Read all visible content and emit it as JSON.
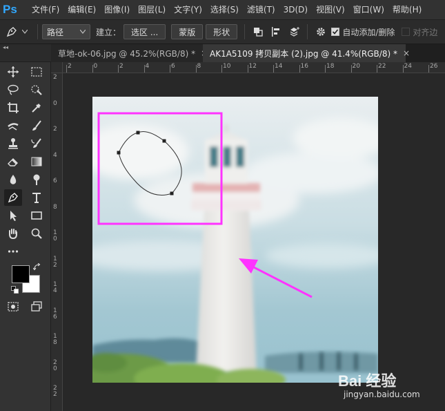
{
  "app": {
    "logo": "Ps"
  },
  "menu": [
    "文件(F)",
    "编辑(E)",
    "图像(I)",
    "图层(L)",
    "文字(Y)",
    "选择(S)",
    "滤镜(T)",
    "3D(D)",
    "视图(V)",
    "窗口(W)",
    "帮助(H)"
  ],
  "options": {
    "mode_value": "路径",
    "make_label": "建立：",
    "selection_button": "选区 ...",
    "mask_button": "蒙版",
    "shape_button": "形状",
    "auto_add_delete": "自动添加/删除",
    "align_edges": "对齐边"
  },
  "tabs": [
    {
      "label": "草地-ok-06.jpg @ 45.2%(RGB/8) *",
      "close": "×",
      "active": false
    },
    {
      "label": "AK1A5109 拷贝副本 (2).jpg @ 41.4%(RGB/8) *",
      "close": "×",
      "active": true
    }
  ],
  "toolbar": {
    "collapse": "◂◂"
  },
  "ruler_h": [
    "2",
    "0",
    "2",
    "4",
    "6",
    "8",
    "10",
    "12",
    "14",
    "16",
    "18",
    "20",
    "22",
    "24",
    "26"
  ],
  "ruler_v": [
    "2",
    "0",
    "2",
    "4",
    "6",
    "8",
    "1\n0",
    "1\n2",
    "1\n4",
    "1\n6",
    "1\n8",
    "2\n0",
    "2\n2"
  ],
  "watermark": {
    "brand": "Bai 经验",
    "url": "jingyan.baidu.com"
  },
  "colors": {
    "accent": "#31a8ff",
    "highlight_box": "#ff33ff",
    "arrow": "#ff33ff",
    "foreground": "#000000",
    "background": "#ffffff"
  }
}
